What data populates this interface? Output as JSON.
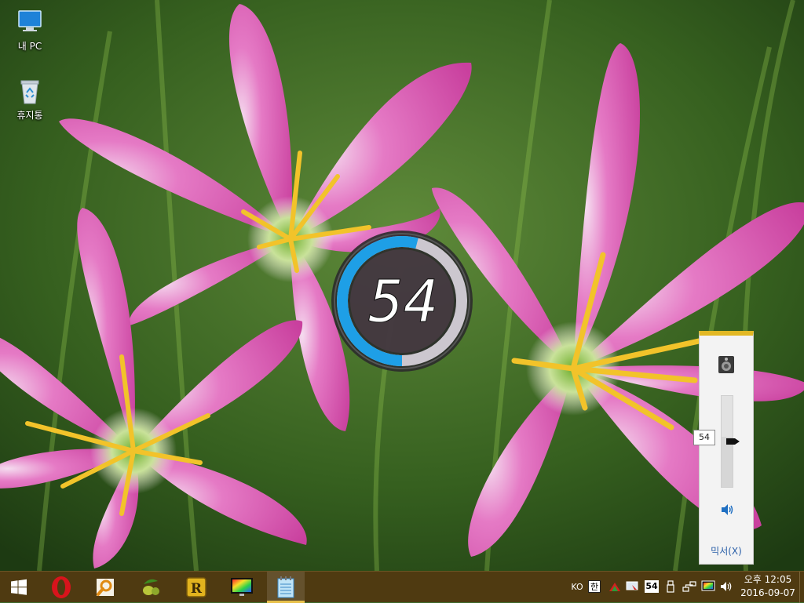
{
  "desktop": {
    "icons": [
      {
        "label": "내 PC",
        "icon": "computer-icon"
      },
      {
        "label": "휴지통",
        "icon": "recycle-bin-icon"
      }
    ]
  },
  "osd": {
    "volume_text": "54",
    "level_fraction": 0.54,
    "ring_color": "#1e9fe6"
  },
  "flyout": {
    "device_icon": "speaker-device-icon",
    "volume_value": "54",
    "volume_level": 0.54,
    "mute_icon": "speaker-icon",
    "mixer_label": "믹서(X)",
    "accent_color": "#e2b824"
  },
  "taskbar": {
    "background": "#4f3a11",
    "pinned": [
      {
        "name": "start",
        "icon": "windows-logo-icon"
      },
      {
        "name": "opera",
        "icon": "opera-icon"
      },
      {
        "name": "search-tool",
        "icon": "magnifier-icon"
      },
      {
        "name": "olive-app",
        "icon": "olive-icon"
      },
      {
        "name": "r-app",
        "icon": "r-app-icon"
      },
      {
        "name": "color-monitor",
        "icon": "monitor-color-icon"
      },
      {
        "name": "notepad",
        "icon": "notepad-icon"
      }
    ],
    "tray": {
      "language": "KO",
      "ime": "한",
      "volume_badge": "54"
    },
    "clock": {
      "time": "오후 12:05",
      "date": "2016-09-07"
    }
  }
}
